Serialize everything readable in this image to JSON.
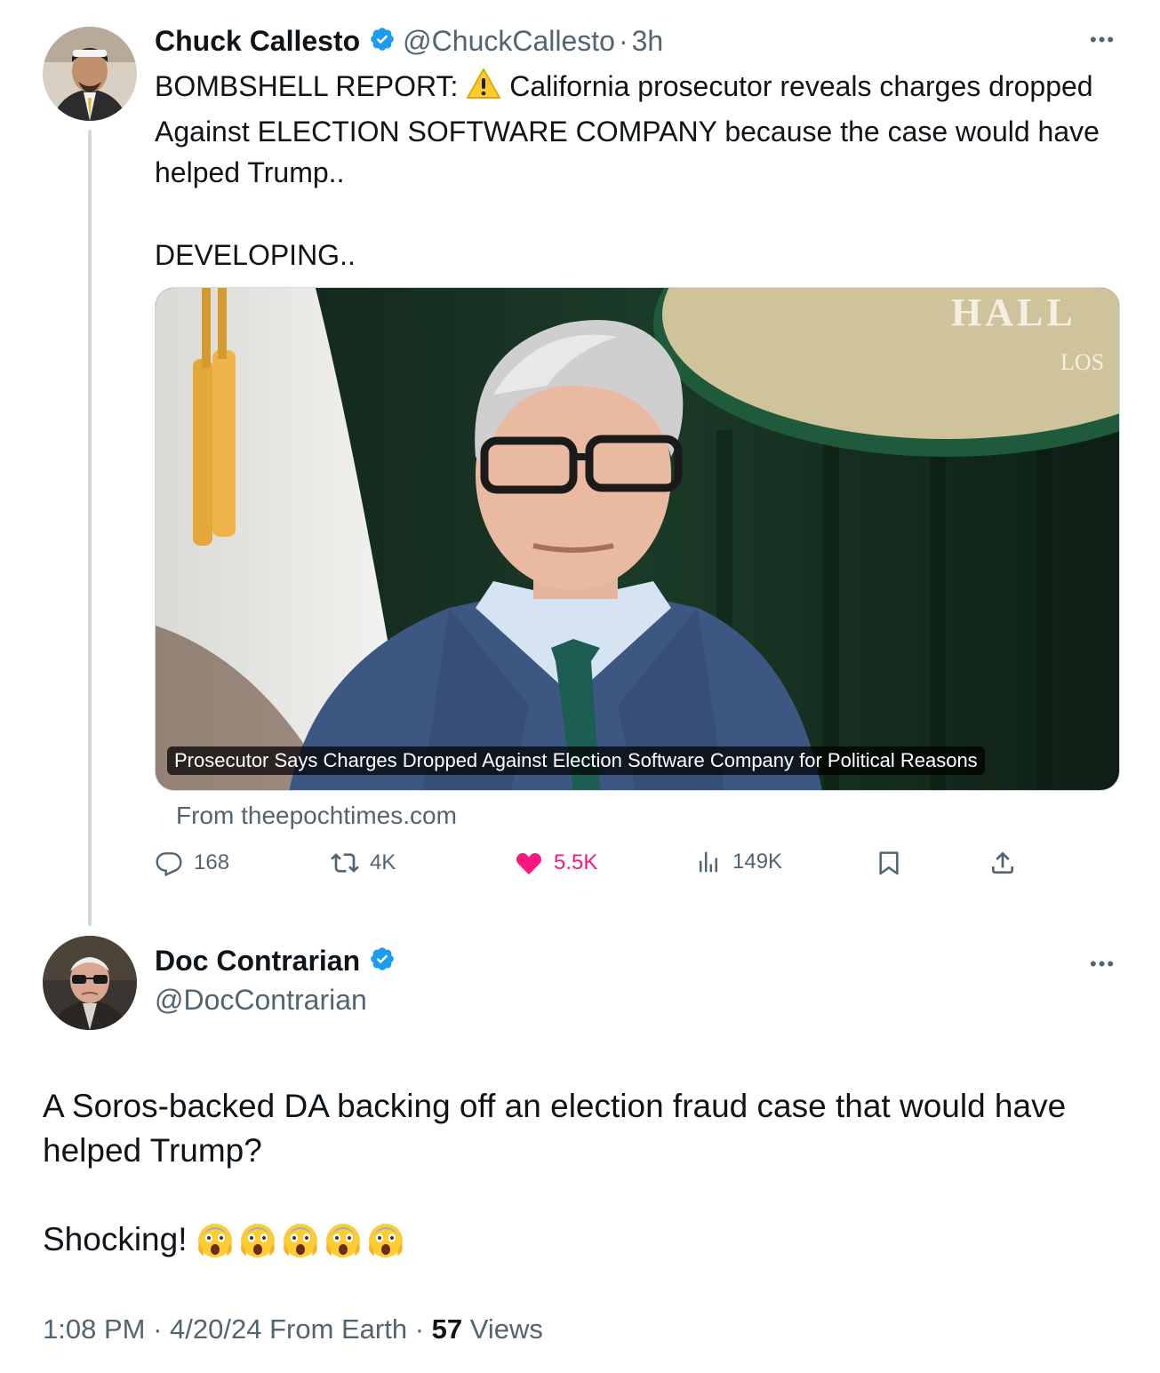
{
  "colors": {
    "text": "#0f1419",
    "secondary": "#536471",
    "verified_blue": "#1d9bf0",
    "like_pink": "#f91880",
    "thread_line": "#cfd9de"
  },
  "tweet1": {
    "author_name": "Chuck Callesto",
    "handle": "@ChuckCallesto",
    "separator": "·",
    "time": "3h",
    "more_icon": "more-dots-icon",
    "text_before_emoji": "BOMBSHELL REPORT: ",
    "text_after_emoji": " California prosecutor reveals charges dropped Against ELECTION SOFTWARE COMPANY because the case would have helped Trump..",
    "text_line2": "DEVELOPING..",
    "card": {
      "caption": "Prosecutor Says Charges Dropped Against Election Software Company for Political Reasons",
      "seal_text_1": "HALL",
      "seal_text_2": "LOS",
      "source": "From theepochtimes.com"
    },
    "actions": {
      "replies": "168",
      "reposts": "4K",
      "likes": "5.5K",
      "views": "149K"
    }
  },
  "tweet2": {
    "author_name": "Doc Contrarian",
    "handle": "@DocContrarian",
    "more_icon": "more-dots-icon",
    "text_line1": "A Soros-backed DA backing off an election fraud case that would have helped Trump?",
    "text_line2": "Shocking!",
    "emoji": "screaming-face-emoji",
    "emoji_count": 5,
    "meta": {
      "time": "1:08 PM",
      "sep1": " · ",
      "date": "4/20/24",
      "source": " From Earth",
      "sep2": " · ",
      "views_count": "57",
      "views_label": " Views"
    }
  }
}
